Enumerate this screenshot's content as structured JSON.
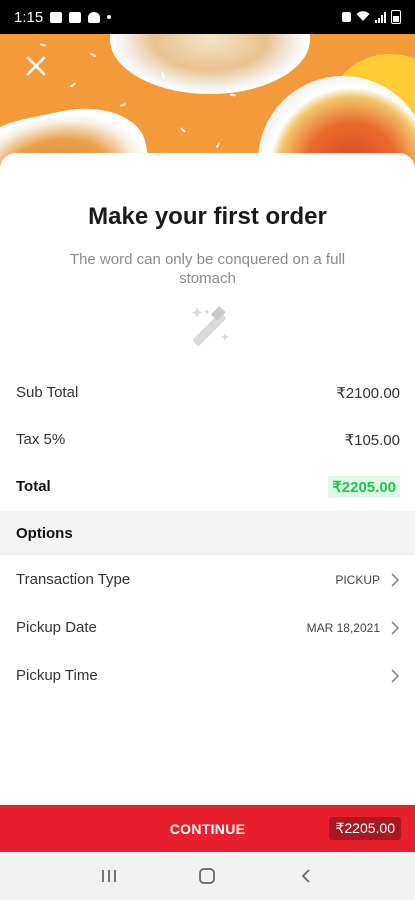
{
  "status_bar": {
    "time": "1:15"
  },
  "header": {
    "close_icon": "close-icon"
  },
  "sheet": {
    "title": "Make your first order",
    "subtitle": "The word can only be conquered on a full stomach",
    "icon": "magic-wand-icon"
  },
  "summary": {
    "sub_total_label": "Sub Total",
    "sub_total_value": "₹2100.00",
    "tax_label": "Tax 5%",
    "tax_value": "₹105.00",
    "total_label": "Total",
    "total_value": "₹2205.00"
  },
  "options": {
    "header": "Options",
    "items": [
      {
        "label": "Transaction Type",
        "value": "PICKUP"
      },
      {
        "label": "Pickup Date",
        "value": "MAR 18,2021"
      },
      {
        "label": "Pickup Time",
        "value": ""
      }
    ]
  },
  "footer": {
    "continue_label": "CONTINUE",
    "amount": "₹2205.00"
  },
  "colors": {
    "accent_red": "#e8202e",
    "total_green": "#1fc553",
    "hero_orange": "#f39a3b"
  }
}
